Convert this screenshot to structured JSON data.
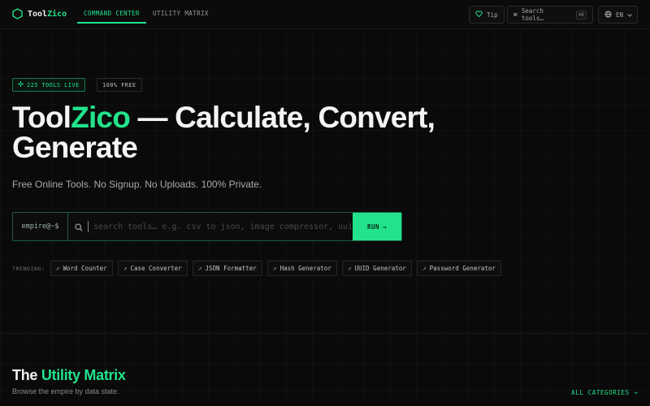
{
  "brand": {
    "name_part1": "Tool",
    "name_part2": "Zico",
    "logo_icon": "hexagon-icon"
  },
  "nav": {
    "tabs": [
      {
        "label": "COMMAND CENTER",
        "active": true
      },
      {
        "label": "UTILITY MATRIX",
        "active": false
      }
    ],
    "tip_label": "Tip",
    "search_label": "Search tools…",
    "search_shortcut": "⌘K",
    "language": "EN"
  },
  "hero": {
    "badges": {
      "live": "225 TOOLS LIVE",
      "free": "100% FREE"
    },
    "title_part1": "Tool",
    "title_part2": "Zico",
    "title_line1_rest": " — Calculate, Convert,",
    "title_line2": "Generate",
    "subtitle": "Free Online Tools. No Signup. No Uploads. 100% Private."
  },
  "search": {
    "prompt": "empire@~$",
    "value": "",
    "placeholder": "search tools… e.g. csv to json, image compressor, uui",
    "run_label": "RUN"
  },
  "trending": {
    "label": "TRENDING:",
    "items": [
      "Word Counter",
      "Case Converter",
      "JSON Formatter",
      "Hash Generator",
      "UUID Generator",
      "Password Generator"
    ]
  },
  "section": {
    "title_part1": "The ",
    "title_part2": "Utility Matrix",
    "subtitle": "Browse the empire by data state.",
    "all_categories": "ALL CATEGORIES"
  },
  "colors": {
    "accent": "#22e38c",
    "background": "#0a0a0a"
  }
}
